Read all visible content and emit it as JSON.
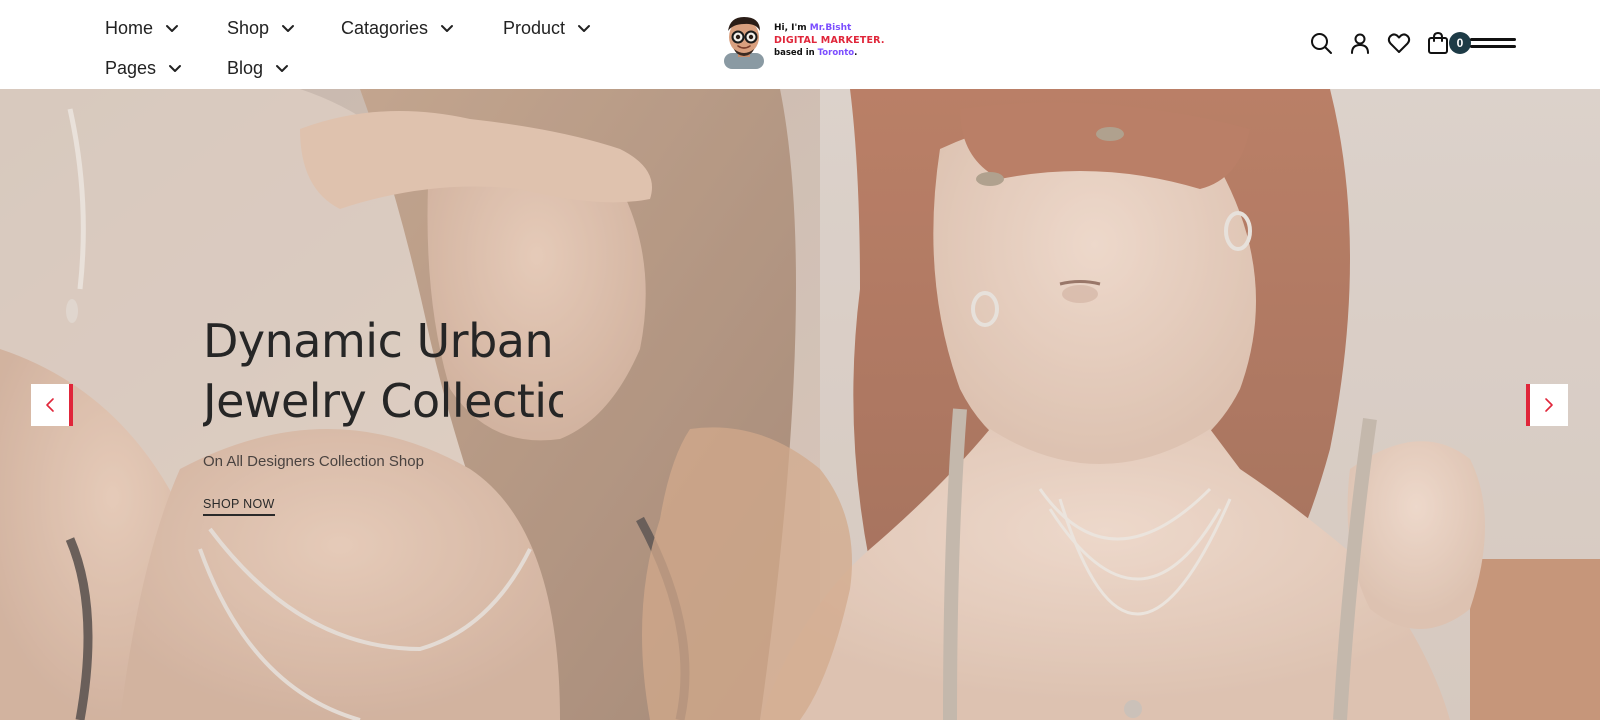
{
  "nav": {
    "row1": [
      {
        "label": "Home"
      },
      {
        "label": "Shop"
      },
      {
        "label": "Catagories"
      },
      {
        "label": "Product"
      }
    ],
    "row2": [
      {
        "label": "Pages"
      },
      {
        "label": "Blog"
      }
    ]
  },
  "logo": {
    "line1_prefix": "Hi, I'm ",
    "line1_name": "Mr.Bisht",
    "line2": "DIGITAL MARKETER.",
    "line3_prefix": "based in ",
    "line3_city": "Toronto",
    "line3_suffix": "."
  },
  "header_icons": {
    "search": "search-icon",
    "account": "user-icon",
    "wishlist": "heart-icon",
    "cart": "shopping-bag-icon",
    "cart_count": "0",
    "menu": "hamburger-menu-icon"
  },
  "hero": {
    "title_line1": "Dynamic Urban L",
    "title_line2": "Jewelry Collectio",
    "subtitle": "On All Designers Collection Shop",
    "cta": "SHOP NOW",
    "prev_arrow": "chevron-left-icon",
    "next_arrow": "chevron-right-icon"
  },
  "colors": {
    "accent": "#e0263a",
    "badge": "#1d3b46",
    "text": "#222222",
    "logo_purple": "#7b4dff"
  }
}
